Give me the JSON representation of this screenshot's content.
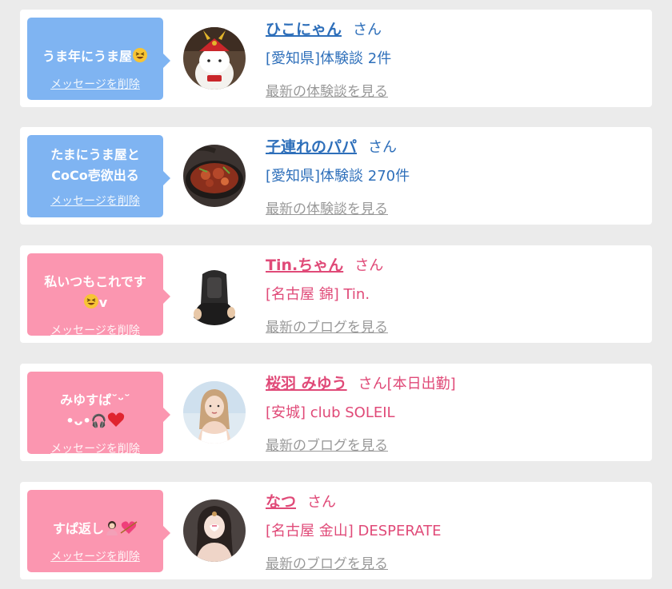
{
  "colors": {
    "background": "#ebebeb",
    "card": "#ffffff",
    "bubble_blue": "#7fb4f2",
    "bubble_pink": "#fb96b0",
    "text_blue": "#2e6fba",
    "text_pink": "#e04a78",
    "link_gray": "#999999"
  },
  "messages": [
    {
      "bubble_text": "うま年にうま屋",
      "bubble_emoji": "laughing-face-emoji",
      "delete_label": "メッセージを削除",
      "name": "ひこにゃん",
      "honorific": "さん",
      "tag": "",
      "subtitle": "[愛知県]体験談 2件",
      "link": "最新の体験談を見る",
      "theme": "blue",
      "avatar_icon": "mascot-avatar-icon"
    },
    {
      "bubble_text": "たまにうま屋と\nCoCo壱欲出る",
      "bubble_emoji": "",
      "delete_label": "メッセージを削除",
      "name": "子連れのパパ",
      "honorific": "さん",
      "tag": "",
      "subtitle": "[愛知県]体験談 270件",
      "link": "最新の体験談を見る",
      "theme": "blue",
      "avatar_icon": "food-plate-avatar-icon"
    },
    {
      "bubble_text": "私いつもこれです\n",
      "bubble_emoji": "laughing-face-emoji",
      "bubble_suffix": "v",
      "delete_label": "メッセージを削除",
      "name": "Tin.ちゃん",
      "honorific": "さん",
      "tag": "",
      "subtitle": "[名古屋 錦] Tin.",
      "link": "最新のブログを見る",
      "theme": "pink",
      "avatar_icon": "hooded-figure-avatar-icon"
    },
    {
      "bubble_text": "みゆすぱ˘ᵕ˘\n•ᴗ•🎧",
      "bubble_emoji": "red-heart-emoji",
      "delete_label": "メッセージを削除",
      "name": "桜羽 みゆう",
      "honorific": "さん",
      "tag": "[本日出勤]",
      "subtitle": "[安城] club SOLEIL",
      "link": "最新のブログを見る",
      "theme": "pink",
      "avatar_icon": "woman-photo-avatar-icon"
    },
    {
      "bubble_text": "すぱ返し",
      "bubble_emoji": "person-and-heart-emoji",
      "delete_label": "メッセージを削除",
      "name": "なつ",
      "honorific": "さん",
      "tag": "",
      "subtitle": "[名古屋 金山] DESPERATE",
      "link": "最新のブログを見る",
      "theme": "pink",
      "avatar_icon": "woman-photo-avatar-icon"
    }
  ]
}
